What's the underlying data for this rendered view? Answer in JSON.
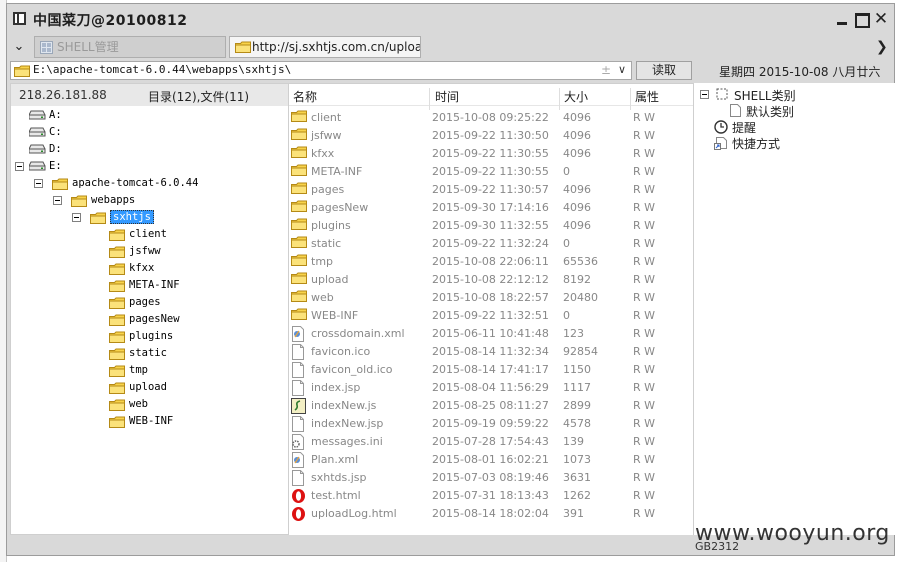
{
  "window": {
    "title": "中国菜刀@20100812"
  },
  "tabs": [
    {
      "label": "SHELL管理"
    },
    {
      "label": "http://sj.sxhtjs.com.cn/upload/p..."
    }
  ],
  "address": {
    "path": "E:\\apache-tomcat-6.0.44\\webapps\\sxhtjs\\",
    "read_button": "读取",
    "date": "星期四 2015-10-08 八月廿六"
  },
  "left": {
    "ip": "218.26.181.88",
    "stats": "目录(12),文件(11)",
    "drives": [
      "A:",
      "C:",
      "D:",
      "E:"
    ],
    "tree": [
      "apache-tomcat-6.0.44",
      "webapps",
      "sxhtjs"
    ],
    "folders": [
      "client",
      "jsfww",
      "kfxx",
      "META-INF",
      "pages",
      "pagesNew",
      "plugins",
      "static",
      "tmp",
      "upload",
      "web",
      "WEB-INF"
    ]
  },
  "columns": {
    "name": "名称",
    "time": "时间",
    "size": "大小",
    "attr": "属性"
  },
  "files": [
    {
      "name": "client",
      "time": "2015-10-08 09:25:22",
      "size": "4096",
      "attr": "R W",
      "icon": "folder-icon"
    },
    {
      "name": "jsfww",
      "time": "2015-09-22 11:30:50",
      "size": "4096",
      "attr": "R W",
      "icon": "folder-icon"
    },
    {
      "name": "kfxx",
      "time": "2015-09-22 11:30:55",
      "size": "4096",
      "attr": "R W",
      "icon": "folder-icon"
    },
    {
      "name": "META-INF",
      "time": "2015-09-22 11:30:55",
      "size": "0",
      "attr": "R W",
      "icon": "folder-icon"
    },
    {
      "name": "pages",
      "time": "2015-09-22 11:30:57",
      "size": "4096",
      "attr": "R W",
      "icon": "folder-icon"
    },
    {
      "name": "pagesNew",
      "time": "2015-09-30 17:14:16",
      "size": "4096",
      "attr": "R W",
      "icon": "folder-icon"
    },
    {
      "name": "plugins",
      "time": "2015-09-30 11:32:55",
      "size": "4096",
      "attr": "R W",
      "icon": "folder-icon"
    },
    {
      "name": "static",
      "time": "2015-09-22 11:32:24",
      "size": "0",
      "attr": "R W",
      "icon": "folder-icon"
    },
    {
      "name": "tmp",
      "time": "2015-10-08 22:06:11",
      "size": "65536",
      "attr": "R W",
      "icon": "folder-icon"
    },
    {
      "name": "upload",
      "time": "2015-10-08 22:12:12",
      "size": "8192",
      "attr": "R W",
      "icon": "folder-icon"
    },
    {
      "name": "web",
      "time": "2015-10-08 18:22:57",
      "size": "20480",
      "attr": "R W",
      "icon": "folder-icon"
    },
    {
      "name": "WEB-INF",
      "time": "2015-09-22 11:32:51",
      "size": "0",
      "attr": "R W",
      "icon": "folder-icon"
    },
    {
      "name": "crossdomain.xml",
      "time": "2015-06-11 10:41:48",
      "size": "123",
      "attr": "R W",
      "icon": "xml-file-icon"
    },
    {
      "name": "favicon.ico",
      "time": "2015-08-14 11:32:34",
      "size": "92854",
      "attr": "R W",
      "icon": "file-icon"
    },
    {
      "name": "favicon_old.ico",
      "time": "2015-08-14 17:41:17",
      "size": "1150",
      "attr": "R W",
      "icon": "file-icon"
    },
    {
      "name": "index.jsp",
      "time": "2015-08-04 11:56:29",
      "size": "1117",
      "attr": "R W",
      "icon": "file-icon"
    },
    {
      "name": "indexNew.js",
      "time": "2015-08-25 08:11:27",
      "size": "2899",
      "attr": "R W",
      "icon": "script-file-icon"
    },
    {
      "name": "indexNew.jsp",
      "time": "2015-09-19 09:59:22",
      "size": "4578",
      "attr": "R W",
      "icon": "file-icon"
    },
    {
      "name": "messages.ini",
      "time": "2015-07-28 17:54:43",
      "size": "139",
      "attr": "R W",
      "icon": "settings-file-icon"
    },
    {
      "name": "Plan.xml",
      "time": "2015-08-01 16:02:21",
      "size": "1073",
      "attr": "R W",
      "icon": "xml-file-icon"
    },
    {
      "name": "sxhtds.jsp",
      "time": "2015-07-03 08:19:46",
      "size": "3631",
      "attr": "R W",
      "icon": "file-icon"
    },
    {
      "name": "test.html",
      "time": "2015-07-31 18:13:43",
      "size": "1262",
      "attr": "R W",
      "icon": "opera-html-icon"
    },
    {
      "name": "uploadLog.html",
      "time": "2015-08-14 18:02:04",
      "size": "391",
      "attr": "R W",
      "icon": "opera-html-icon"
    }
  ],
  "categories": {
    "shell": "SHELL类别",
    "default": "默认类别",
    "reminder": "提醒",
    "shortcut": "快捷方式"
  },
  "status": {
    "encoding": "GB2312"
  },
  "watermark": "www.wooyun.org"
}
